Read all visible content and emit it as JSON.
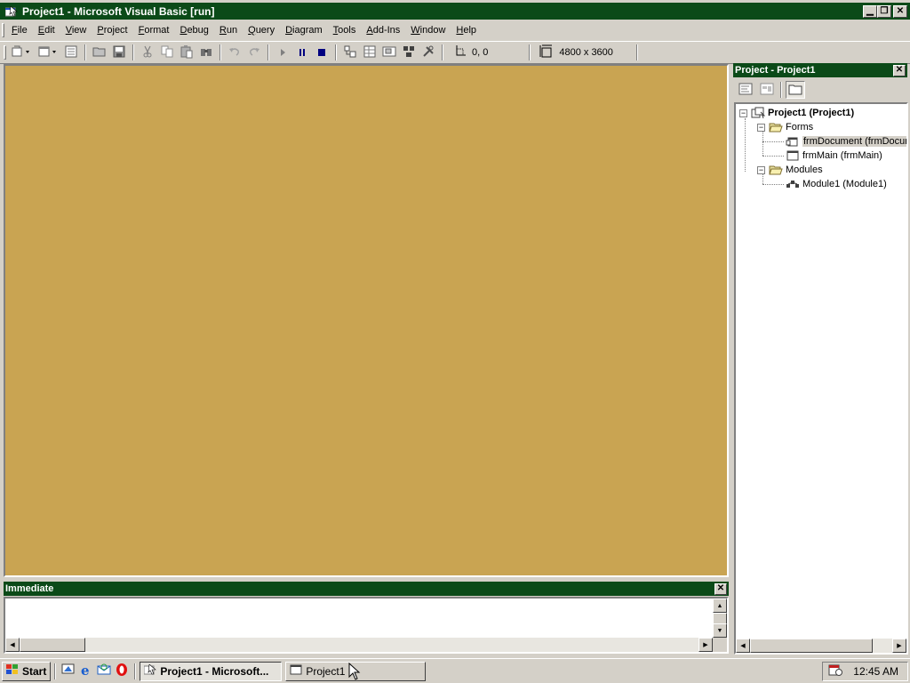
{
  "window": {
    "title": "Project1 - Microsoft Visual Basic [run]",
    "caption_buttons": [
      "minimize",
      "maximize",
      "close"
    ]
  },
  "menu": [
    "File",
    "Edit",
    "View",
    "Project",
    "Format",
    "Debug",
    "Run",
    "Query",
    "Diagram",
    "Tools",
    "Add-Ins",
    "Window",
    "Help"
  ],
  "toolbar": {
    "icons": [
      "add-project-icon",
      "add-form-icon",
      "menu-editor-icon",
      "open-project-icon",
      "save-project-icon",
      "cut-icon",
      "copy-icon",
      "paste-icon",
      "find-icon",
      "undo-icon",
      "redo-icon",
      "start-icon",
      "break-icon",
      "end-icon",
      "project-explorer-icon",
      "properties-window-icon",
      "form-layout-icon",
      "object-browser-icon",
      "toolbox-icon"
    ],
    "position_readout": "0, 0",
    "size_readout": "4800 x 3600"
  },
  "form_canvas": {
    "background": "#c9a452"
  },
  "immediate": {
    "title": "Immediate",
    "content": ""
  },
  "project_panel": {
    "title": "Project - Project1",
    "toolbar": [
      "view-code",
      "view-object",
      "toggle-folders"
    ],
    "tree": {
      "root": "Project1 (Project1)",
      "forms_folder": "Forms",
      "forms": [
        "frmDocument (frmDocument)",
        "frmMain (frmMain)"
      ],
      "modules_folder": "Modules",
      "modules": [
        "Module1 (Module1)"
      ]
    }
  },
  "taskbar": {
    "start_label": "Start",
    "quick_launch": [
      "show-desktop-icon",
      "internet-explorer-icon",
      "outlook-express-icon",
      "opera-icon"
    ],
    "tasks": [
      "Project1 - Microsoft...",
      "Project1"
    ],
    "clock": "12:45 AM"
  },
  "colors": {
    "title_bar": "#0b4a18",
    "chrome": "#d4d0c8",
    "form_background": "#c9a452"
  }
}
